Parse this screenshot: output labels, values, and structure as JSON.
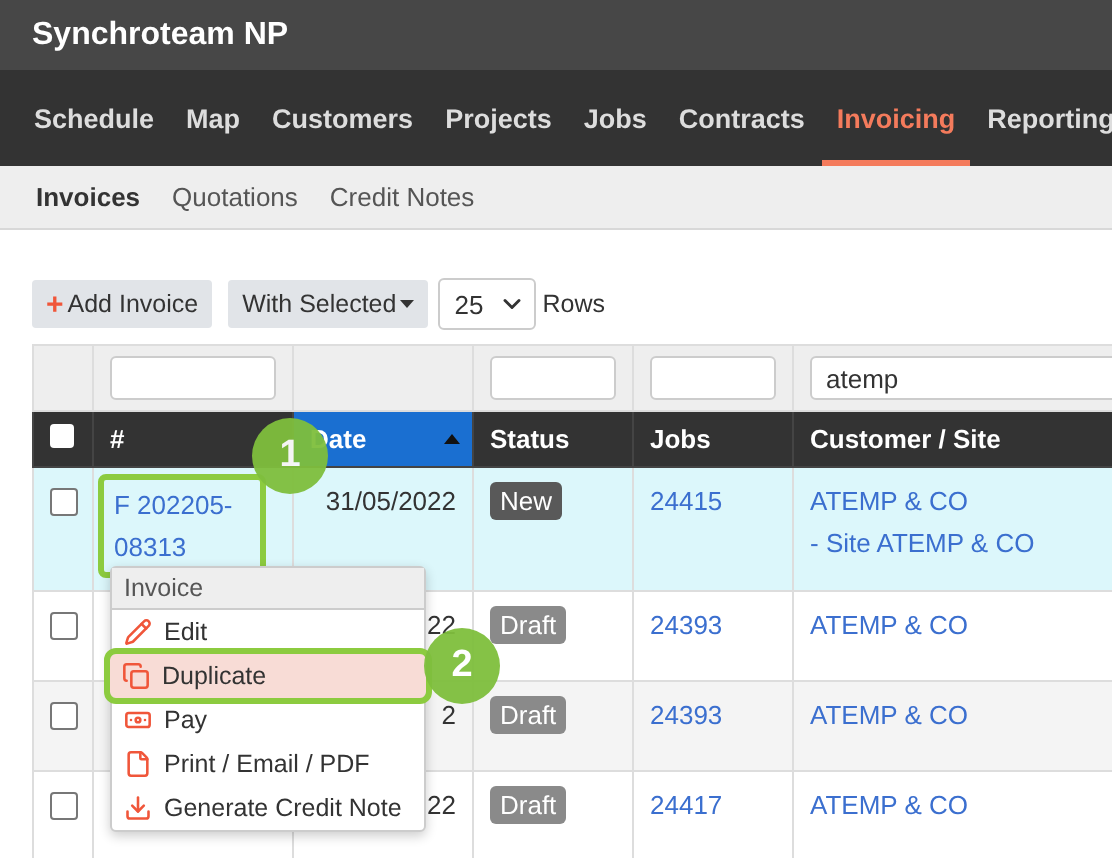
{
  "app_title": "Synchroteam NP",
  "nav": [
    {
      "label": "Schedule",
      "selected": false
    },
    {
      "label": "Map",
      "selected": false
    },
    {
      "label": "Customers",
      "selected": false
    },
    {
      "label": "Projects",
      "selected": false
    },
    {
      "label": "Jobs",
      "selected": false
    },
    {
      "label": "Contracts",
      "selected": false
    },
    {
      "label": "Invoicing",
      "selected": true
    },
    {
      "label": "Reporting",
      "selected": false
    }
  ],
  "subnav": [
    {
      "label": "Invoices",
      "selected": true
    },
    {
      "label": "Quotations",
      "selected": false
    },
    {
      "label": "Credit Notes",
      "selected": false
    }
  ],
  "toolbar": {
    "add_icon": "+",
    "add_label": "Add Invoice",
    "with_selected": "With Selected",
    "rows_value": "25",
    "rows_label": "Rows"
  },
  "table": {
    "filters": [
      {
        "kind": "none"
      },
      {
        "kind": "field"
      },
      {
        "kind": "none"
      },
      {
        "kind": "field"
      },
      {
        "kind": "field"
      },
      {
        "kind": "field",
        "value": "atemp"
      }
    ],
    "columns": [
      {
        "kind": "checkbox",
        "checked": false
      },
      {
        "kind": "text",
        "label": "#",
        "sorted": false
      },
      {
        "kind": "text",
        "label": "Date",
        "sorted": true
      },
      {
        "kind": "text",
        "label": "Status",
        "sorted": false
      },
      {
        "kind": "text",
        "label": "Jobs",
        "sorted": false
      },
      {
        "kind": "text",
        "label": "Customer / Site",
        "sorted": false
      }
    ],
    "rows": [
      {
        "selected": true,
        "checked": false,
        "number": "F 202205-08313",
        "number_callout": "1",
        "date": "31/05/2022",
        "status": {
          "label": "New",
          "color": "#595959"
        },
        "job": "24415",
        "customer": [
          "ATEMP & CO",
          "- Site ATEMP & CO"
        ]
      },
      {
        "selected": false,
        "checked": false,
        "date": "22",
        "status": {
          "label": "Draft",
          "color": "#8a8a8a"
        },
        "job": "24393",
        "customer": [
          "ATEMP & CO"
        ]
      },
      {
        "selected": false,
        "checked": false,
        "date": "2",
        "status": {
          "label": "Draft",
          "color": "#8a8a8a"
        },
        "job": "24393",
        "customer": [
          "ATEMP & CO"
        ]
      },
      {
        "selected": false,
        "checked": false,
        "date": "22",
        "status": {
          "label": "Draft",
          "color": "#8a8a8a"
        },
        "job": "24417",
        "customer": [
          "ATEMP & CO"
        ]
      }
    ]
  },
  "context_menu": {
    "title": "Invoice",
    "items": [
      {
        "kind": "edit",
        "label": "Edit",
        "selected": false
      },
      {
        "kind": "duplicate",
        "label": "Duplicate",
        "selected": true,
        "callout": "2"
      },
      {
        "kind": "pay",
        "label": "Pay",
        "selected": false
      },
      {
        "kind": "print",
        "label": "Print / Email / PDF",
        "selected": false
      },
      {
        "kind": "credit",
        "label": "Generate Credit Note",
        "selected": false
      }
    ]
  }
}
